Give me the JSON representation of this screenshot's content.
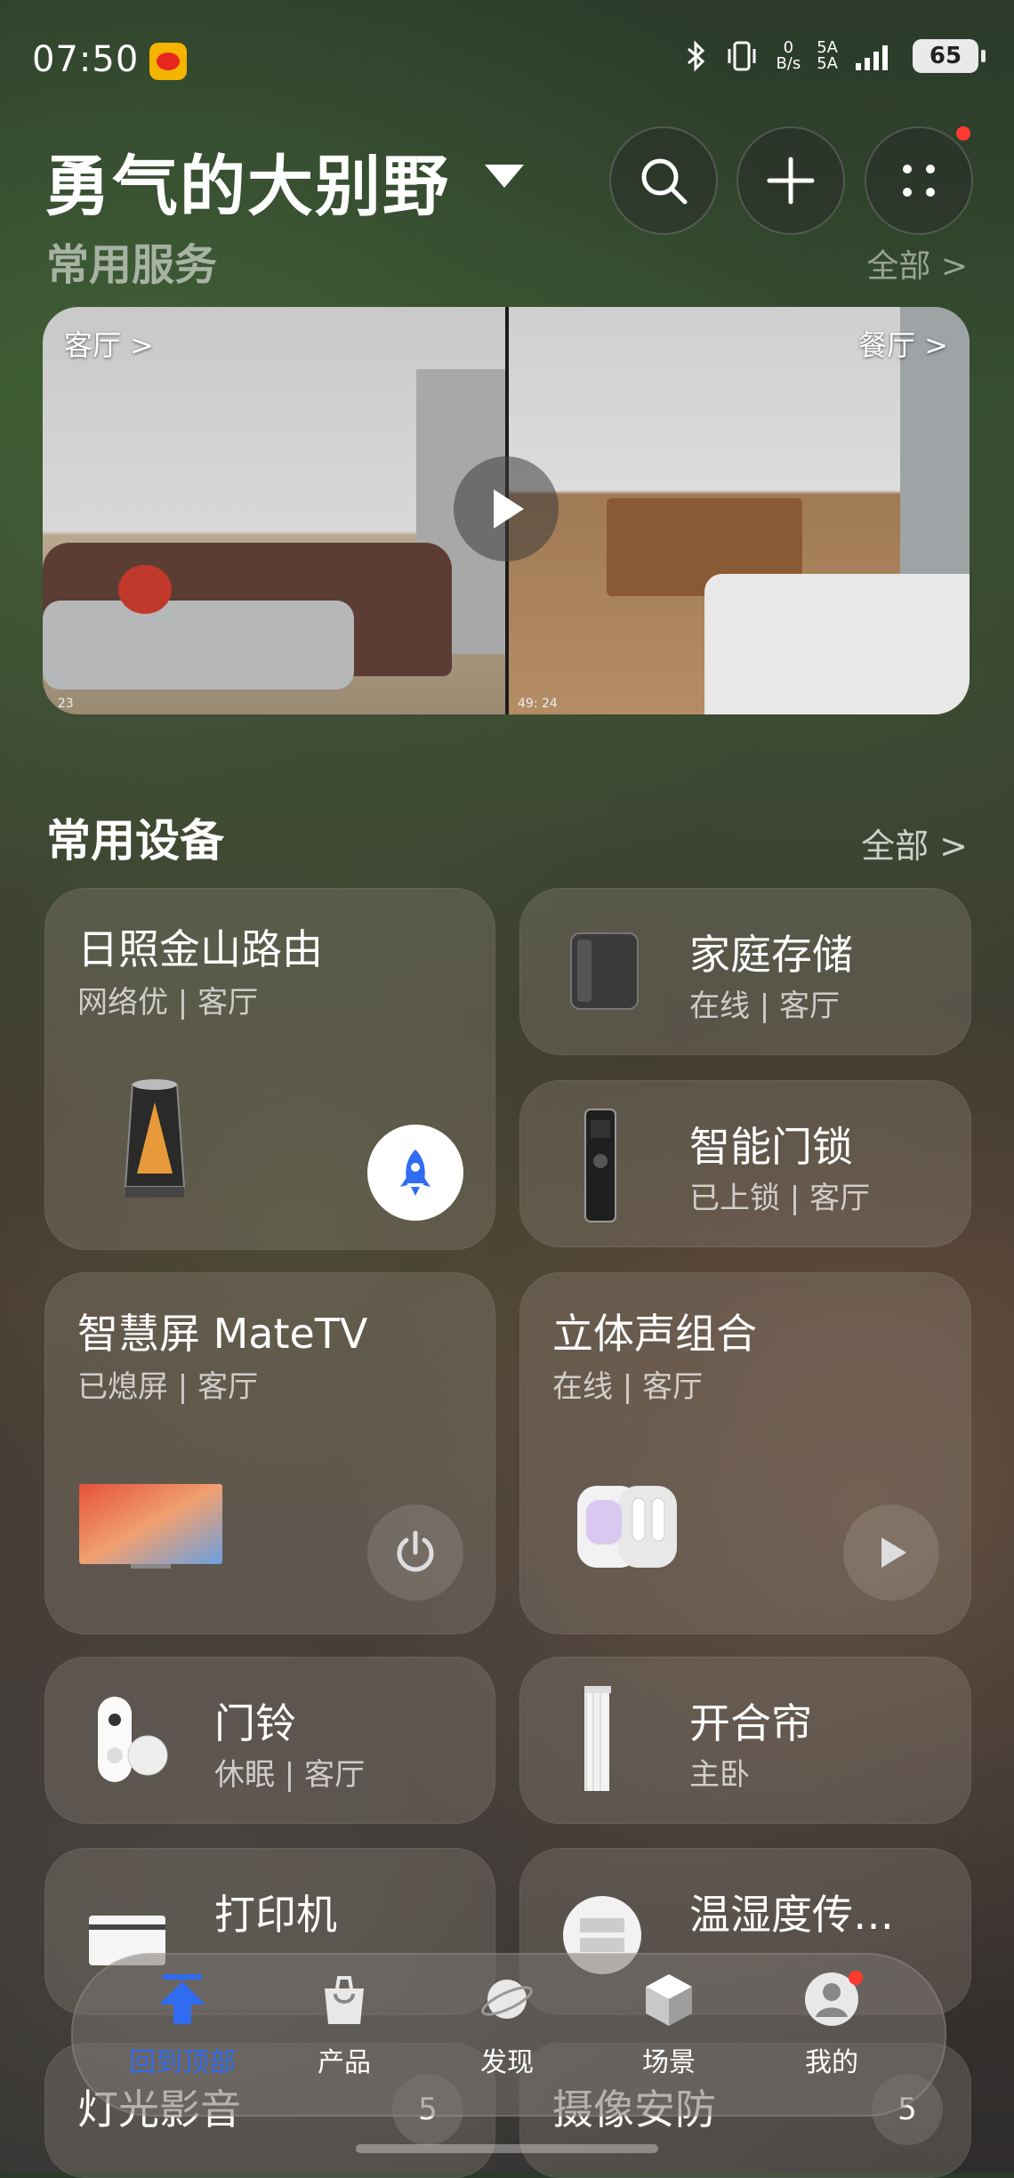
{
  "status_bar": {
    "time": "07:50",
    "net_speed_top": "0",
    "net_speed_bottom": "B/s",
    "signal1": "5A",
    "signal2": "5A",
    "battery": "65"
  },
  "header": {
    "home_name": "勇气的大别野"
  },
  "services": {
    "title": "常用服务",
    "all": "全部 >"
  },
  "camera": {
    "left_room": "客厅 >",
    "right_room": "餐厅 >",
    "left_ts": ". 23",
    "right_ts": "49: 24"
  },
  "devices": {
    "title": "常用设备",
    "all": "全部 >",
    "items": [
      {
        "name": "日照金山路由",
        "status": "网络优 | 客厅"
      },
      {
        "name": "家庭存储",
        "status": "在线 | 客厅"
      },
      {
        "name": "智能门锁",
        "status": "已上锁 | 客厅"
      },
      {
        "name": "智慧屏 MateTV",
        "status": "已熄屏 | 客厅"
      },
      {
        "name": "立体声组合",
        "status": "在线 | 客厅"
      },
      {
        "name": "门铃",
        "status": "休眠 | 客厅"
      },
      {
        "name": "开合帘",
        "status": "主卧"
      },
      {
        "name": "打印机",
        "status": ""
      },
      {
        "name": "温湿度传…",
        "status": ""
      }
    ]
  },
  "scenes": [
    {
      "name": "灯光影音",
      "count": "5"
    },
    {
      "name": "摄像安防",
      "count": "5"
    }
  ],
  "nav": {
    "items": [
      "回到顶部",
      "产品",
      "发现",
      "场景",
      "我的"
    ]
  },
  "colors": {
    "accent": "#2f6cf0",
    "badge": "#ff3b30"
  }
}
